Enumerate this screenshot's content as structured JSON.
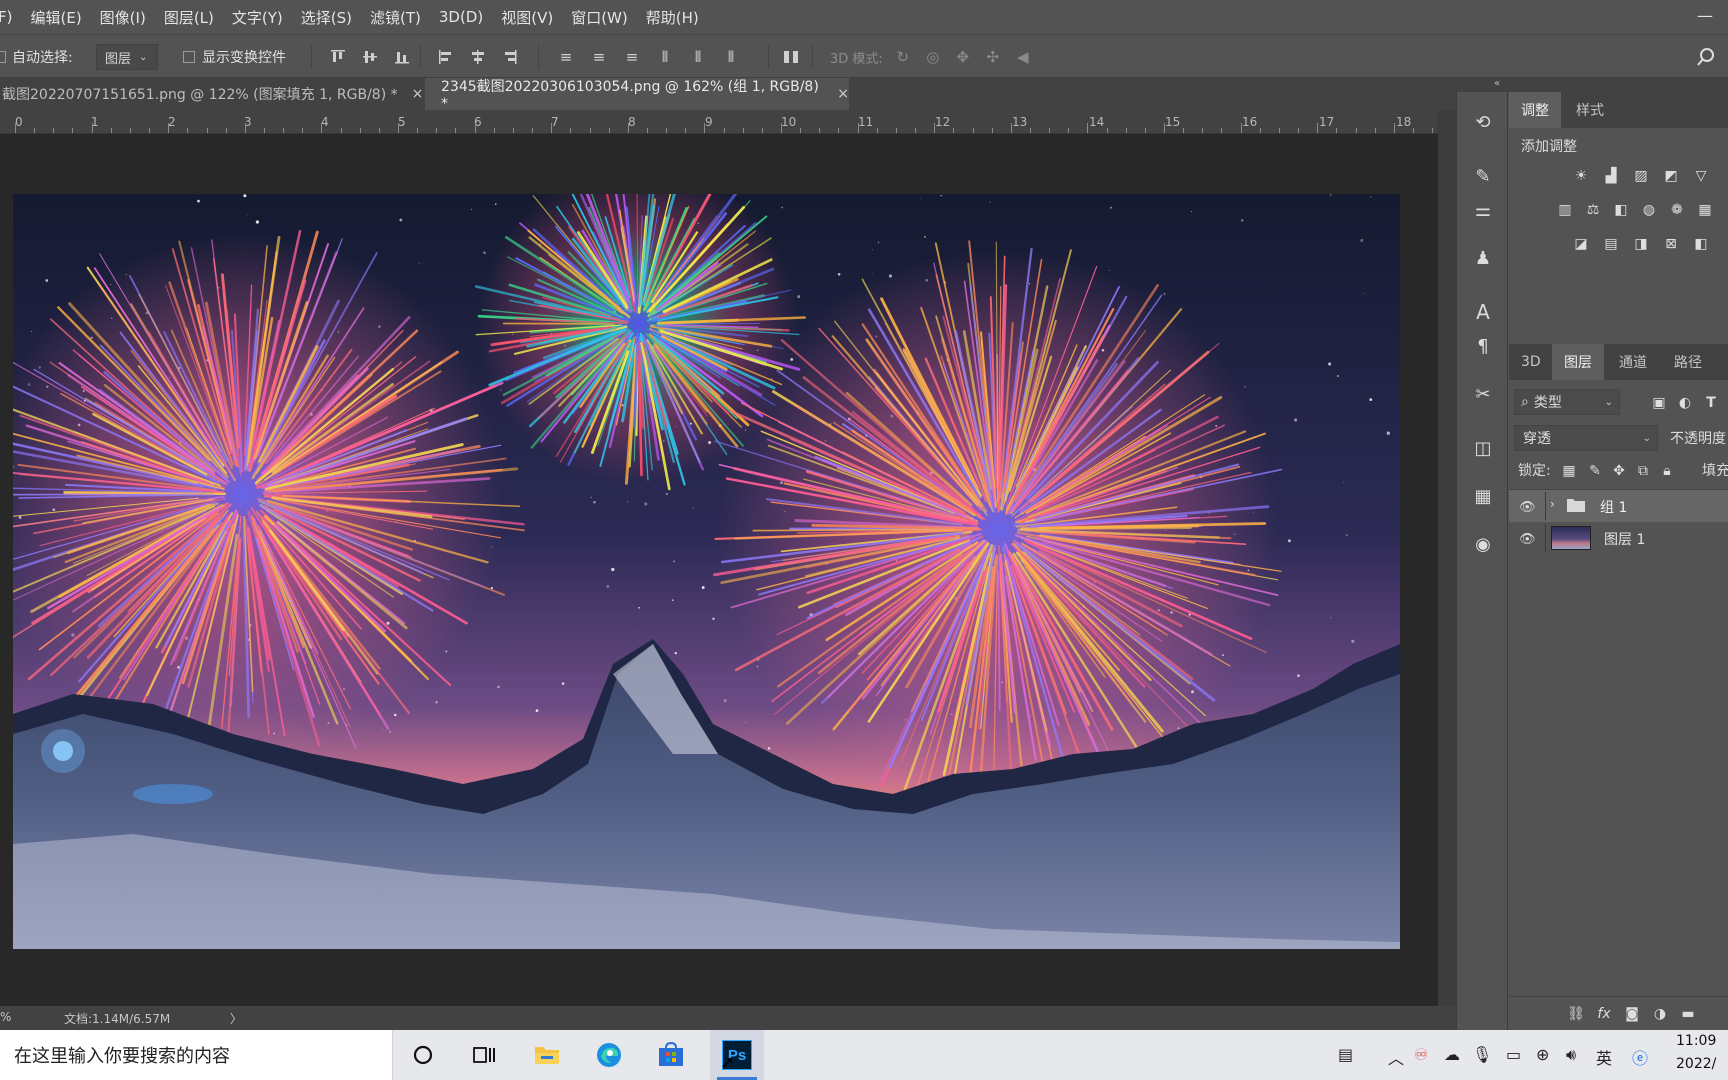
{
  "menu": {
    "items": [
      "F)",
      "编辑(E)",
      "图像(I)",
      "图层(L)",
      "文字(Y)",
      "选择(S)",
      "滤镜(T)",
      "3D(D)",
      "视图(V)",
      "窗口(W)",
      "帮助(H)"
    ]
  },
  "window": {
    "minimize_icon": "minus-icon"
  },
  "options_bar": {
    "auto_select_label": "自动选择:",
    "auto_select_value": "图层",
    "show_transform_label": "显示变换控件",
    "mode_3d_label": "3D 模式:"
  },
  "tabs": [
    {
      "label": "截图20220707151651.png @ 122% (图案填充 1, RGB/8) *",
      "close": "×",
      "active": false
    },
    {
      "label": "2345截图20220306103054.png @ 162% (组 1, RGB/8) *",
      "close": "×",
      "active": true
    }
  ],
  "ruler": {
    "labels": [
      "0",
      "1",
      "2",
      "3",
      "4",
      "5",
      "6",
      "7",
      "8",
      "9",
      "10",
      "11",
      "12",
      "13",
      "14",
      "15",
      "16",
      "17",
      "18"
    ]
  },
  "status": {
    "zoom": "%",
    "doc": "文档:1.14M/6.57M",
    "arrow": "〉"
  },
  "collapse_label": "«",
  "adjust_panel": {
    "tabs": [
      "调整",
      "样式"
    ],
    "active_tab": "调整",
    "add_label": "添加调整"
  },
  "layers_panel": {
    "tabs": [
      "3D",
      "图层",
      "通道",
      "路径"
    ],
    "active_tab": "图层",
    "filter_label": "类型",
    "blend_mode": "穿透",
    "opacity_label": "不透明度",
    "lock_label": "锁定:",
    "fill_label": "填充",
    "layers": [
      {
        "name": "组 1",
        "kind": "group",
        "visible": true,
        "selected": true
      },
      {
        "name": "图层 1",
        "kind": "image",
        "visible": true,
        "selected": false
      }
    ]
  },
  "taskbar": {
    "search_placeholder": "在这里输入你要搜索的内容",
    "ps_label": "Ps",
    "clock_time": "11:09",
    "clock_date": "2022/"
  },
  "colors": {
    "ui_bg": "#535353",
    "dark_bg": "#424242",
    "canvas_bg": "#282828",
    "ps_blue": "#31a8ff",
    "ps_dark": "#001e36"
  }
}
